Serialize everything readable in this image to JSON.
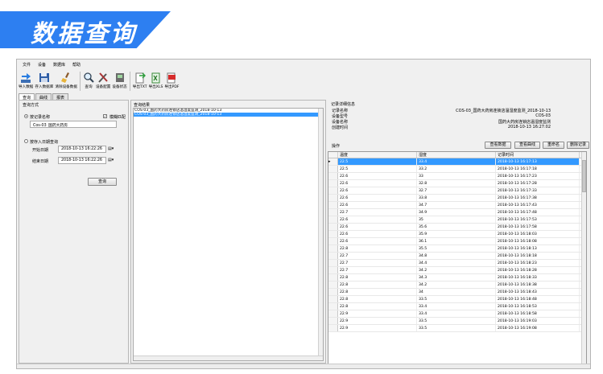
{
  "banner": {
    "title": "数据查询",
    "color": "#2d7ff1"
  },
  "menu": [
    "文件",
    "设备",
    "数据库",
    "帮助"
  ],
  "toolbar": [
    {
      "label": "导入数据",
      "icon": "import-arrow-icon"
    },
    {
      "label": "存入数据库",
      "icon": "save-database-icon"
    },
    {
      "label": "清除设备数据",
      "icon": "broom-clear-icon"
    },
    {
      "label": "查询",
      "icon": "magnifier-icon"
    },
    {
      "label": "设备配置",
      "icon": "tools-config-icon"
    },
    {
      "label": "设备状态",
      "icon": "device-status-icon"
    },
    {
      "label": "导出TXT",
      "icon": "export-txt-icon"
    },
    {
      "label": "导出XLS",
      "icon": "export-xls-icon"
    },
    {
      "label": "导出PDF",
      "icon": "export-pdf-icon"
    }
  ],
  "tabs": [
    "查询",
    "曲线",
    "报表"
  ],
  "query": {
    "group_label": "查询方式",
    "by_name_label": "按记录名称",
    "fuzzy_label": "模糊匹配",
    "name_value": "Cos-03_国药大药房",
    "by_date_label": "按存入日期查询",
    "start_label": "开始日期",
    "start_value": "2018-10-13 16:22:26",
    "end_label": "结束日期",
    "end_value": "2018-10-13 16:22:26",
    "query_button": "查询"
  },
  "results": {
    "label": "查询结果",
    "items": [
      "COS-03_国药大药房连锁店温湿度监测_2018-10-13",
      "COS-03_国药大药房连锁店温湿度监测_2018-10-13"
    ],
    "selected_index": 1
  },
  "detail": {
    "label": "记录详细信息",
    "fields": [
      {
        "key": "记录名称",
        "value": "COS-03_国药大药房连锁店温湿度监测_2018-10-13"
      },
      {
        "key": "设备型号",
        "value": "COS-03"
      },
      {
        "key": "设备名称",
        "value": "国药大药房连锁店温湿度监测"
      },
      {
        "key": "创建时间",
        "value": "2018-10-13 16:27:02"
      }
    ],
    "ops_label": "操作",
    "buttons": [
      "查看数据",
      "查看曲线",
      "重命名",
      "删除记录"
    ]
  },
  "table": {
    "columns": [
      "温度",
      "湿度",
      "记录时间"
    ],
    "selected_row": 0,
    "rows": [
      [
        "22.5",
        "33.4",
        "2018-10-13 16:17:13"
      ],
      [
        "22.5",
        "33.2",
        "2018-10-13 16:17:18"
      ],
      [
        "22.6",
        "33",
        "2018-10-13 16:17:23"
      ],
      [
        "22.6",
        "32.8",
        "2018-10-13 16:17:28"
      ],
      [
        "22.6",
        "32.7",
        "2018-10-13 16:17:33"
      ],
      [
        "22.6",
        "33.8",
        "2018-10-13 16:17:38"
      ],
      [
        "22.6",
        "34.7",
        "2018-10-13 16:17:43"
      ],
      [
        "22.7",
        "34.9",
        "2018-10-13 16:17:48"
      ],
      [
        "22.6",
        "35",
        "2018-10-13 16:17:53"
      ],
      [
        "22.6",
        "35.6",
        "2018-10-13 16:17:58"
      ],
      [
        "22.6",
        "35.9",
        "2018-10-13 16:18:03"
      ],
      [
        "22.6",
        "36.1",
        "2018-10-13 16:18:08"
      ],
      [
        "22.8",
        "35.5",
        "2018-10-13 16:18:13"
      ],
      [
        "22.7",
        "34.8",
        "2018-10-13 16:18:18"
      ],
      [
        "22.7",
        "34.4",
        "2018-10-13 16:18:23"
      ],
      [
        "22.7",
        "34.2",
        "2018-10-13 16:18:28"
      ],
      [
        "22.8",
        "34.3",
        "2018-10-13 16:18:33"
      ],
      [
        "22.8",
        "34.2",
        "2018-10-13 16:18:38"
      ],
      [
        "22.8",
        "34",
        "2018-10-13 16:18:43"
      ],
      [
        "22.8",
        "33.5",
        "2018-10-13 16:18:48"
      ],
      [
        "22.8",
        "33.4",
        "2018-10-13 16:18:53"
      ],
      [
        "22.9",
        "33.4",
        "2018-10-13 16:18:58"
      ],
      [
        "22.9",
        "33.5",
        "2018-10-13 16:19:03"
      ],
      [
        "22.9",
        "33.5",
        "2018-10-13 16:19:08"
      ]
    ]
  }
}
